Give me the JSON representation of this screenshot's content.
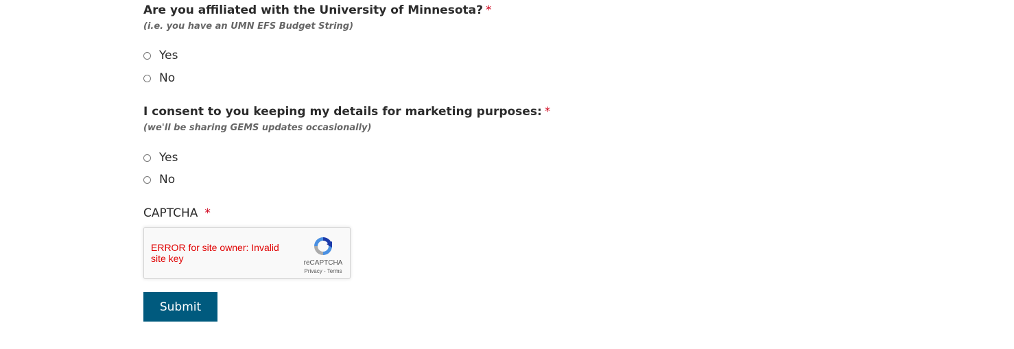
{
  "question1": {
    "label": "Are you affiliated with the University of Minnesota?",
    "required_mark": "*",
    "hint": "(i.e. you have an UMN EFS Budget String)",
    "options": [
      "Yes",
      "No"
    ]
  },
  "question2": {
    "label": "I consent to you keeping my details for marketing purposes:",
    "required_mark": "*",
    "hint": "(we'll be sharing GEMS updates occasionally)",
    "options": [
      "Yes",
      "No"
    ]
  },
  "captcha": {
    "label": "CAPTCHA",
    "required_mark": "*",
    "error": "ERROR for site owner: Invalid site key",
    "brand": "reCAPTCHA",
    "privacy": "Privacy",
    "separator": " - ",
    "terms": "Terms"
  },
  "submit": {
    "label": "Submit"
  },
  "colors": {
    "required": "#d0021b",
    "button": "#005a7e",
    "error": "#e00000"
  }
}
